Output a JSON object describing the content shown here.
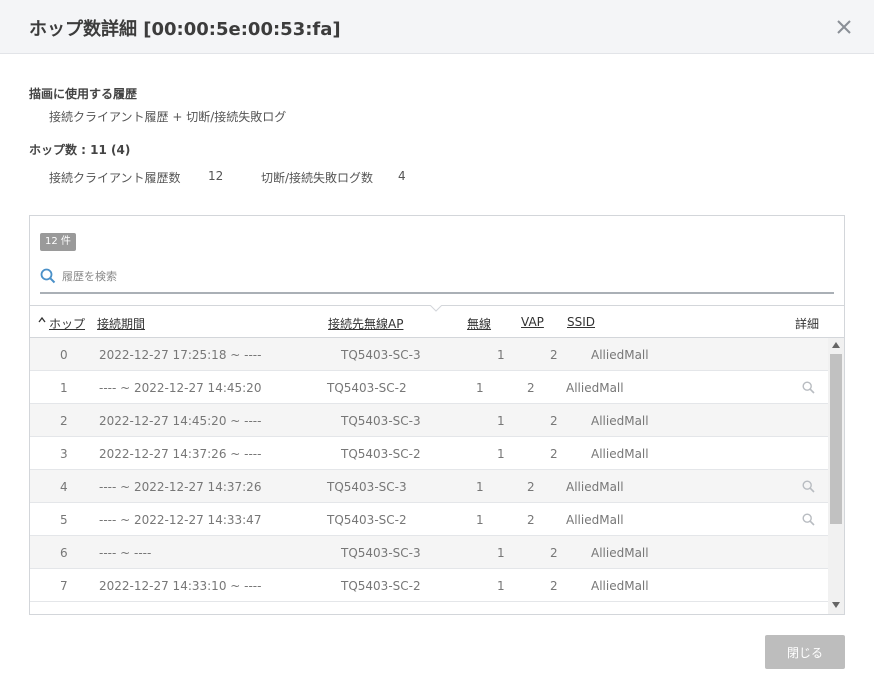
{
  "dialog": {
    "title": "ホップ数詳細 [00:00:5e:00:53:fa]"
  },
  "summary": {
    "history_label": "描画に使用する履歴",
    "history_value": "接続クライアント履歴 + 切断/接続失敗ログ",
    "hops_label": "ホップ数 : 11 (4)",
    "client_history_label": "接続クライアント履歴数",
    "client_history_count": "12",
    "fail_log_label": "切断/接続失敗ログ数",
    "fail_log_count": "4"
  },
  "list": {
    "count_badge": "12 件",
    "search_placeholder": "履歴を検索",
    "columns": {
      "hop": "ホップ",
      "period": "接続期間",
      "ap": "接続先無線AP",
      "radio": "無線",
      "vap": "VAP",
      "ssid": "SSID",
      "detail": "詳細"
    },
    "rows": [
      {
        "hop": "0",
        "period": "2022-12-27 17:25:18 ~ ----",
        "ap": "TQ5403-SC-3",
        "radio": "1",
        "vap": "2",
        "ssid": "AlliedMall",
        "detail": false,
        "indented": true
      },
      {
        "hop": "1",
        "period": "---- ~ 2022-12-27 14:45:20",
        "ap": "TQ5403-SC-2",
        "radio": "1",
        "vap": "2",
        "ssid": "AlliedMall",
        "detail": true,
        "indented": false
      },
      {
        "hop": "2",
        "period": "2022-12-27 14:45:20 ~ ----",
        "ap": "TQ5403-SC-3",
        "radio": "1",
        "vap": "2",
        "ssid": "AlliedMall",
        "detail": false,
        "indented": true
      },
      {
        "hop": "3",
        "period": "2022-12-27 14:37:26 ~ ----",
        "ap": "TQ5403-SC-2",
        "radio": "1",
        "vap": "2",
        "ssid": "AlliedMall",
        "detail": false,
        "indented": true
      },
      {
        "hop": "4",
        "period": "---- ~ 2022-12-27 14:37:26",
        "ap": "TQ5403-SC-3",
        "radio": "1",
        "vap": "2",
        "ssid": "AlliedMall",
        "detail": true,
        "indented": false
      },
      {
        "hop": "5",
        "period": "---- ~ 2022-12-27 14:33:47",
        "ap": "TQ5403-SC-2",
        "radio": "1",
        "vap": "2",
        "ssid": "AlliedMall",
        "detail": true,
        "indented": false
      },
      {
        "hop": "6",
        "period": "---- ~ ----",
        "ap": "TQ5403-SC-3",
        "radio": "1",
        "vap": "2",
        "ssid": "AlliedMall",
        "detail": false,
        "indented": true
      },
      {
        "hop": "7",
        "period": "2022-12-27 14:33:10 ~ ----",
        "ap": "TQ5403-SC-2",
        "radio": "1",
        "vap": "2",
        "ssid": "AlliedMall",
        "detail": false,
        "indented": true
      }
    ]
  },
  "footer": {
    "close_label": "閉じる"
  },
  "icons": {
    "close": "close-icon",
    "search": "search-icon",
    "detail": "magnifier-icon",
    "sort": "sort-ascending-icon"
  },
  "colors": {
    "header_bg": "#f4f5f7",
    "badge_bg": "#9a9a9a",
    "search_icon": "#4a90c8",
    "button_bg": "#bdbdbd"
  }
}
